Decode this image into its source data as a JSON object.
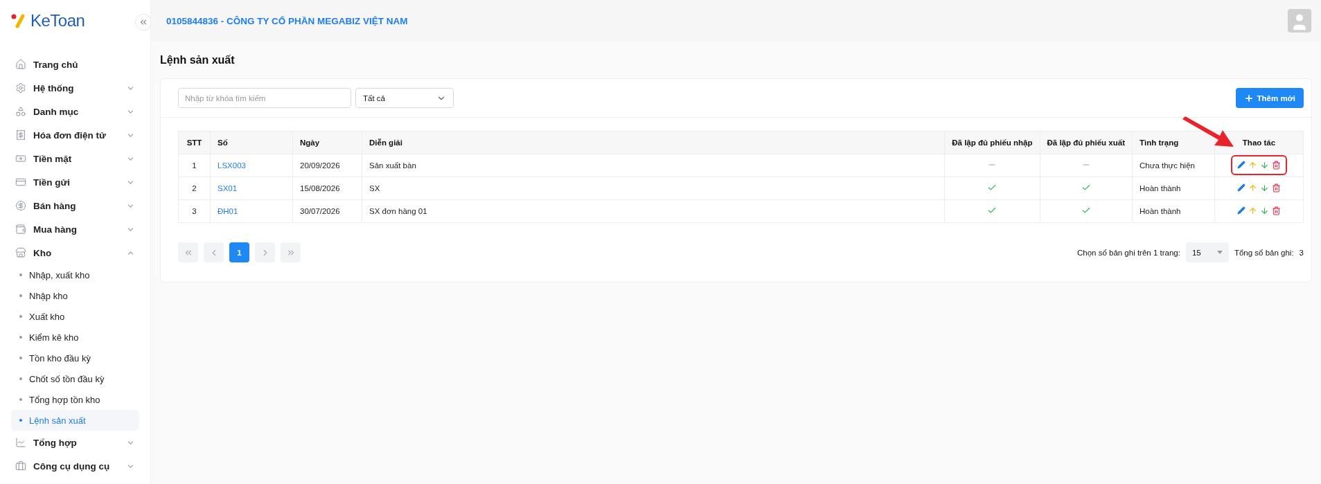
{
  "logo": {
    "text": "KeToan"
  },
  "header": {
    "company": "0105844836 - CÔNG TY CỔ PHẦN MEGABIZ VIỆT NAM"
  },
  "sidebar": {
    "items": [
      {
        "label": "Trang chủ"
      },
      {
        "label": "Hệ thống",
        "expanded": false
      },
      {
        "label": "Danh mục",
        "expanded": false
      },
      {
        "label": "Hóa đơn điện tử",
        "expanded": false
      },
      {
        "label": "Tiền mặt",
        "expanded": false
      },
      {
        "label": "Tiền gửi",
        "expanded": false
      },
      {
        "label": "Bán hàng",
        "expanded": false
      },
      {
        "label": "Mua hàng",
        "expanded": false
      },
      {
        "label": "Kho",
        "expanded": true,
        "children": [
          {
            "label": "Nhập, xuất kho",
            "selected": false
          },
          {
            "label": "Nhập kho",
            "selected": false
          },
          {
            "label": "Xuất kho",
            "selected": false
          },
          {
            "label": "Kiểm kê kho",
            "selected": false
          },
          {
            "label": "Tồn kho đầu kỳ",
            "selected": false
          },
          {
            "label": "Chốt số tồn đầu kỳ",
            "selected": false
          },
          {
            "label": "Tổng hợp tồn kho",
            "selected": false
          },
          {
            "label": "Lệnh sản xuất",
            "selected": true
          }
        ]
      },
      {
        "label": "Tổng hợp",
        "expanded": false
      },
      {
        "label": "Công cụ dụng cụ",
        "expanded": false
      }
    ]
  },
  "page": {
    "title": "Lệnh sản xuất"
  },
  "toolbar": {
    "search": {
      "placeholder": "Nhập từ khóa tìm kiếm"
    },
    "filter": {
      "value": "Tất cả"
    },
    "add_button": "Thêm mới"
  },
  "table": {
    "columns": [
      "STT",
      "Số",
      "Ngày",
      "Diễn giải",
      "Đã lập đủ phiếu nhập",
      "Đã lập đủ phiếu xuất",
      "Tình trạng",
      "Thao tác"
    ],
    "rows": [
      {
        "stt": "1",
        "so": "LSX003",
        "ngay": "20/09/2026",
        "dien_giai": "Sản xuất bàn",
        "nhap_done": false,
        "xuat_done": false,
        "status": "Chưa thực hiện",
        "highlighted": true
      },
      {
        "stt": "2",
        "so": "SX01",
        "ngay": "15/08/2026",
        "dien_giai": "SX",
        "nhap_done": true,
        "xuat_done": true,
        "status": "Hoàn thành",
        "highlighted": false
      },
      {
        "stt": "3",
        "so": "ĐH01",
        "ngay": "30/07/2026",
        "dien_giai": "SX đơn hàng 01",
        "nhap_done": true,
        "xuat_done": true,
        "status": "Hoàn thành",
        "highlighted": false
      }
    ]
  },
  "pagination": {
    "pages": [
      {
        "label": "1",
        "selected": true
      }
    ],
    "per_page_label": "Chọn số bản ghi trên 1 trang:",
    "per_page": "15",
    "total_label": "Tổng số bản ghi:",
    "total": "3"
  }
}
